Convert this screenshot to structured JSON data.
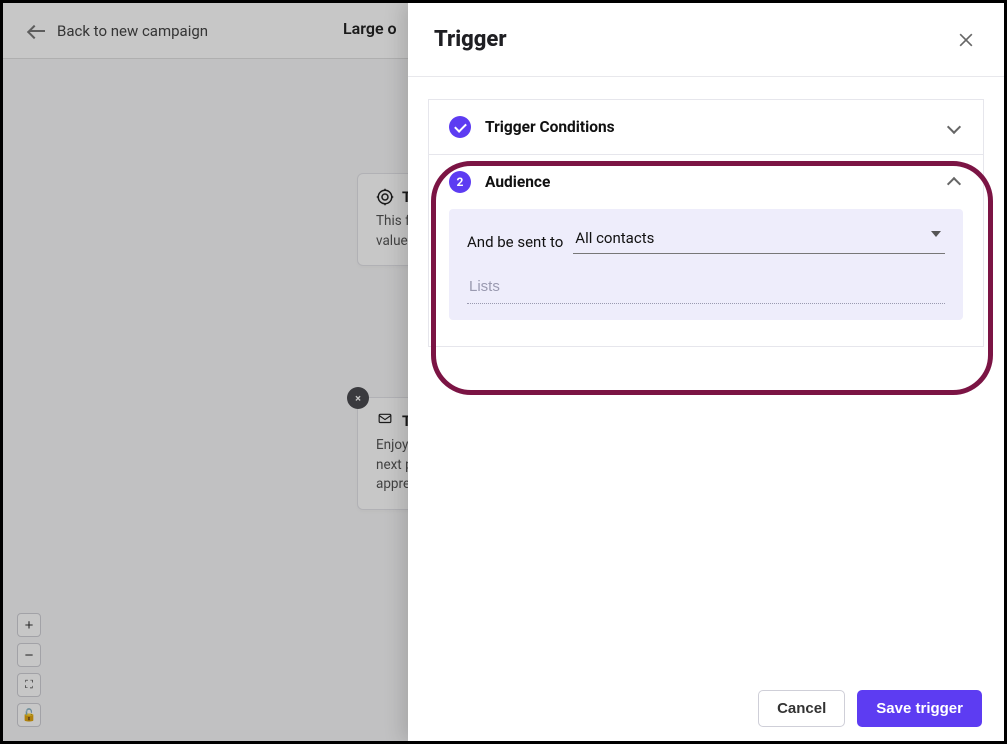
{
  "bg": {
    "back_label": "Back to new campaign",
    "center_title": "Large o",
    "card1": {
      "title": "T",
      "body_line1": "This f",
      "body_line2": "value"
    },
    "card2": {
      "title": "T",
      "body_line1": "Enjoy",
      "body_line2": "next p",
      "body_line3": "appre"
    },
    "close_badge": "×",
    "toolbar": {
      "zoom_in": "+",
      "zoom_out": "−",
      "fullscreen": "⛶",
      "lock": "🔓"
    }
  },
  "panel": {
    "title": "Trigger",
    "sections": {
      "conditions": {
        "label": "Trigger Conditions"
      },
      "audience": {
        "label": "Audience",
        "step": "2",
        "prefix": "And be sent to",
        "selected": "All contacts",
        "lists_placeholder": "Lists"
      }
    },
    "footer": {
      "cancel": "Cancel",
      "save": "Save trigger"
    }
  }
}
